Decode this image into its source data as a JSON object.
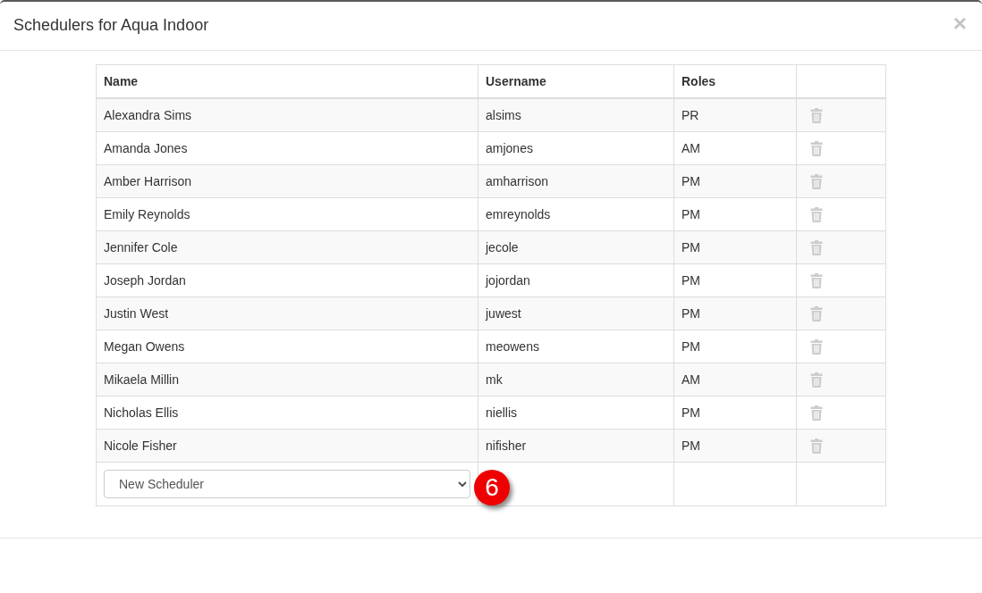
{
  "dialog": {
    "title": "Schedulers for Aqua Indoor",
    "close_glyph": "×"
  },
  "table": {
    "columns": [
      "Name",
      "Username",
      "Roles"
    ],
    "rows": [
      {
        "name": "Alexandra Sims",
        "username": "alsims",
        "roles": "PR"
      },
      {
        "name": "Amanda Jones",
        "username": "amjones",
        "roles": "AM"
      },
      {
        "name": "Amber Harrison",
        "username": "amharrison",
        "roles": "PM"
      },
      {
        "name": "Emily Reynolds",
        "username": "emreynolds",
        "roles": "PM"
      },
      {
        "name": "Jennifer Cole",
        "username": "jecole",
        "roles": "PM"
      },
      {
        "name": "Joseph Jordan",
        "username": "jojordan",
        "roles": "PM"
      },
      {
        "name": "Justin West",
        "username": "juwest",
        "roles": "PM"
      },
      {
        "name": "Megan Owens",
        "username": "meowens",
        "roles": "PM"
      },
      {
        "name": "Mikaela Millin",
        "username": "mk",
        "roles": "AM"
      },
      {
        "name": "Nicholas Ellis",
        "username": "niellis",
        "roles": "PM"
      },
      {
        "name": "Nicole Fisher",
        "username": "nifisher",
        "roles": "PM"
      }
    ],
    "new_scheduler_select": {
      "value": "New Scheduler"
    },
    "step_badge": "6"
  }
}
